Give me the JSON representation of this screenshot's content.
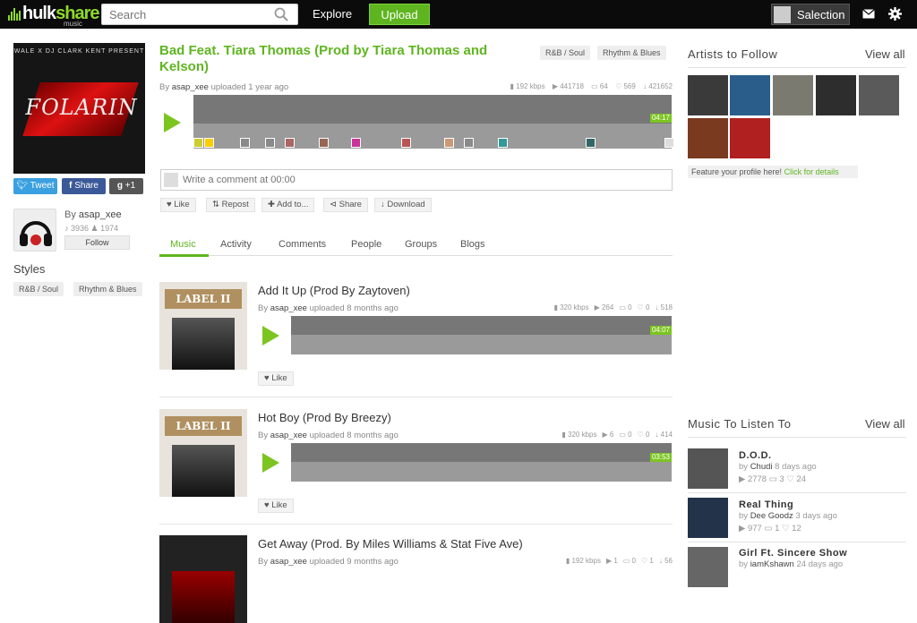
{
  "brand": {
    "name_a": "hulk",
    "name_b": "share",
    "sub": "music",
    "accent": "#7cc520"
  },
  "search": {
    "placeholder": "Search"
  },
  "nav": {
    "explore": "Explore",
    "upload": "Upload"
  },
  "user": {
    "name": "Salection"
  },
  "main_track": {
    "cover_top": "WALE X DJ CLARK KENT PRESENT",
    "cover_word": "FOLARIN",
    "title": "Bad Feat. Tiara Thomas (Prod by Tiara Thomas and Kelson)",
    "by": "By",
    "user": "asap_xee",
    "uploaded": "uploaded 1 year ago",
    "tags": [
      "R&B / Soul",
      "Rhythm & Blues"
    ],
    "stats": {
      "kbps": "192 kbps",
      "plays": "441718",
      "comments": "64",
      "likes": "569",
      "downloads": "421652"
    },
    "duration": "04:17"
  },
  "share": {
    "tweet": "Tweet",
    "facebook": "Share",
    "gplus": "+1"
  },
  "uploader": {
    "by": "By",
    "name": "asap_xee",
    "followers": "3936",
    "following": "1974",
    "follow": "Follow"
  },
  "styles": {
    "heading": "Styles",
    "tags": [
      "R&B / Soul",
      "Rhythm & Blues"
    ]
  },
  "comment": {
    "placeholder": "Write a comment at 00:00"
  },
  "actions": {
    "like": "Like",
    "repost": "Repost",
    "add": "Add to...",
    "share": "Share",
    "download": "Download"
  },
  "tabs": [
    "Music",
    "Activity",
    "Comments",
    "People",
    "Groups",
    "Blogs"
  ],
  "tracks": [
    {
      "title": "Add It Up (Prod By Zaytoven)",
      "by": "By",
      "user": "asap_xee",
      "uploaded": "uploaded 8 months ago",
      "kbps": "320 kbps",
      "plays": "264",
      "comments": "0",
      "likes": "0",
      "downloads": "518",
      "duration": "04:07",
      "like": "Like",
      "cover": "LABEL II"
    },
    {
      "title": "Hot Boy (Prod By Breezy)",
      "by": "By",
      "user": "asap_xee",
      "uploaded": "uploaded 8 months ago",
      "kbps": "320 kbps",
      "plays": "6",
      "comments": "0",
      "likes": "0",
      "downloads": "414",
      "duration": "03:53",
      "like": "Like",
      "cover": "LABEL II"
    },
    {
      "title": "Get Away (Prod. By Miles Williams & Stat Five Ave)",
      "by": "By",
      "user": "asap_xee",
      "uploaded": "uploaded 9 months ago",
      "kbps": "192 kbps",
      "plays": "1",
      "comments": "0",
      "likes": "1",
      "downloads": "56"
    }
  ],
  "artists": {
    "heading": "Artists to Follow",
    "view_all": "View all",
    "feature": "Feature your profile here!",
    "feature_link": "Click for details"
  },
  "listen": {
    "heading": "Music To Listen To",
    "view_all": "View all",
    "items": [
      {
        "title": "D.O.D.",
        "by": "by",
        "user": "Chudi",
        "ago": "8 days ago",
        "plays": "2778",
        "comments": "3",
        "likes": "24"
      },
      {
        "title": "Real Thing",
        "by": "by",
        "user": "Dee Goodz",
        "ago": "3 days ago",
        "plays": "977",
        "comments": "1",
        "likes": "12"
      },
      {
        "title": "Girl Ft. Sincere Show",
        "by": "by",
        "user": "iamKshawn",
        "ago": "24 days ago"
      }
    ]
  }
}
